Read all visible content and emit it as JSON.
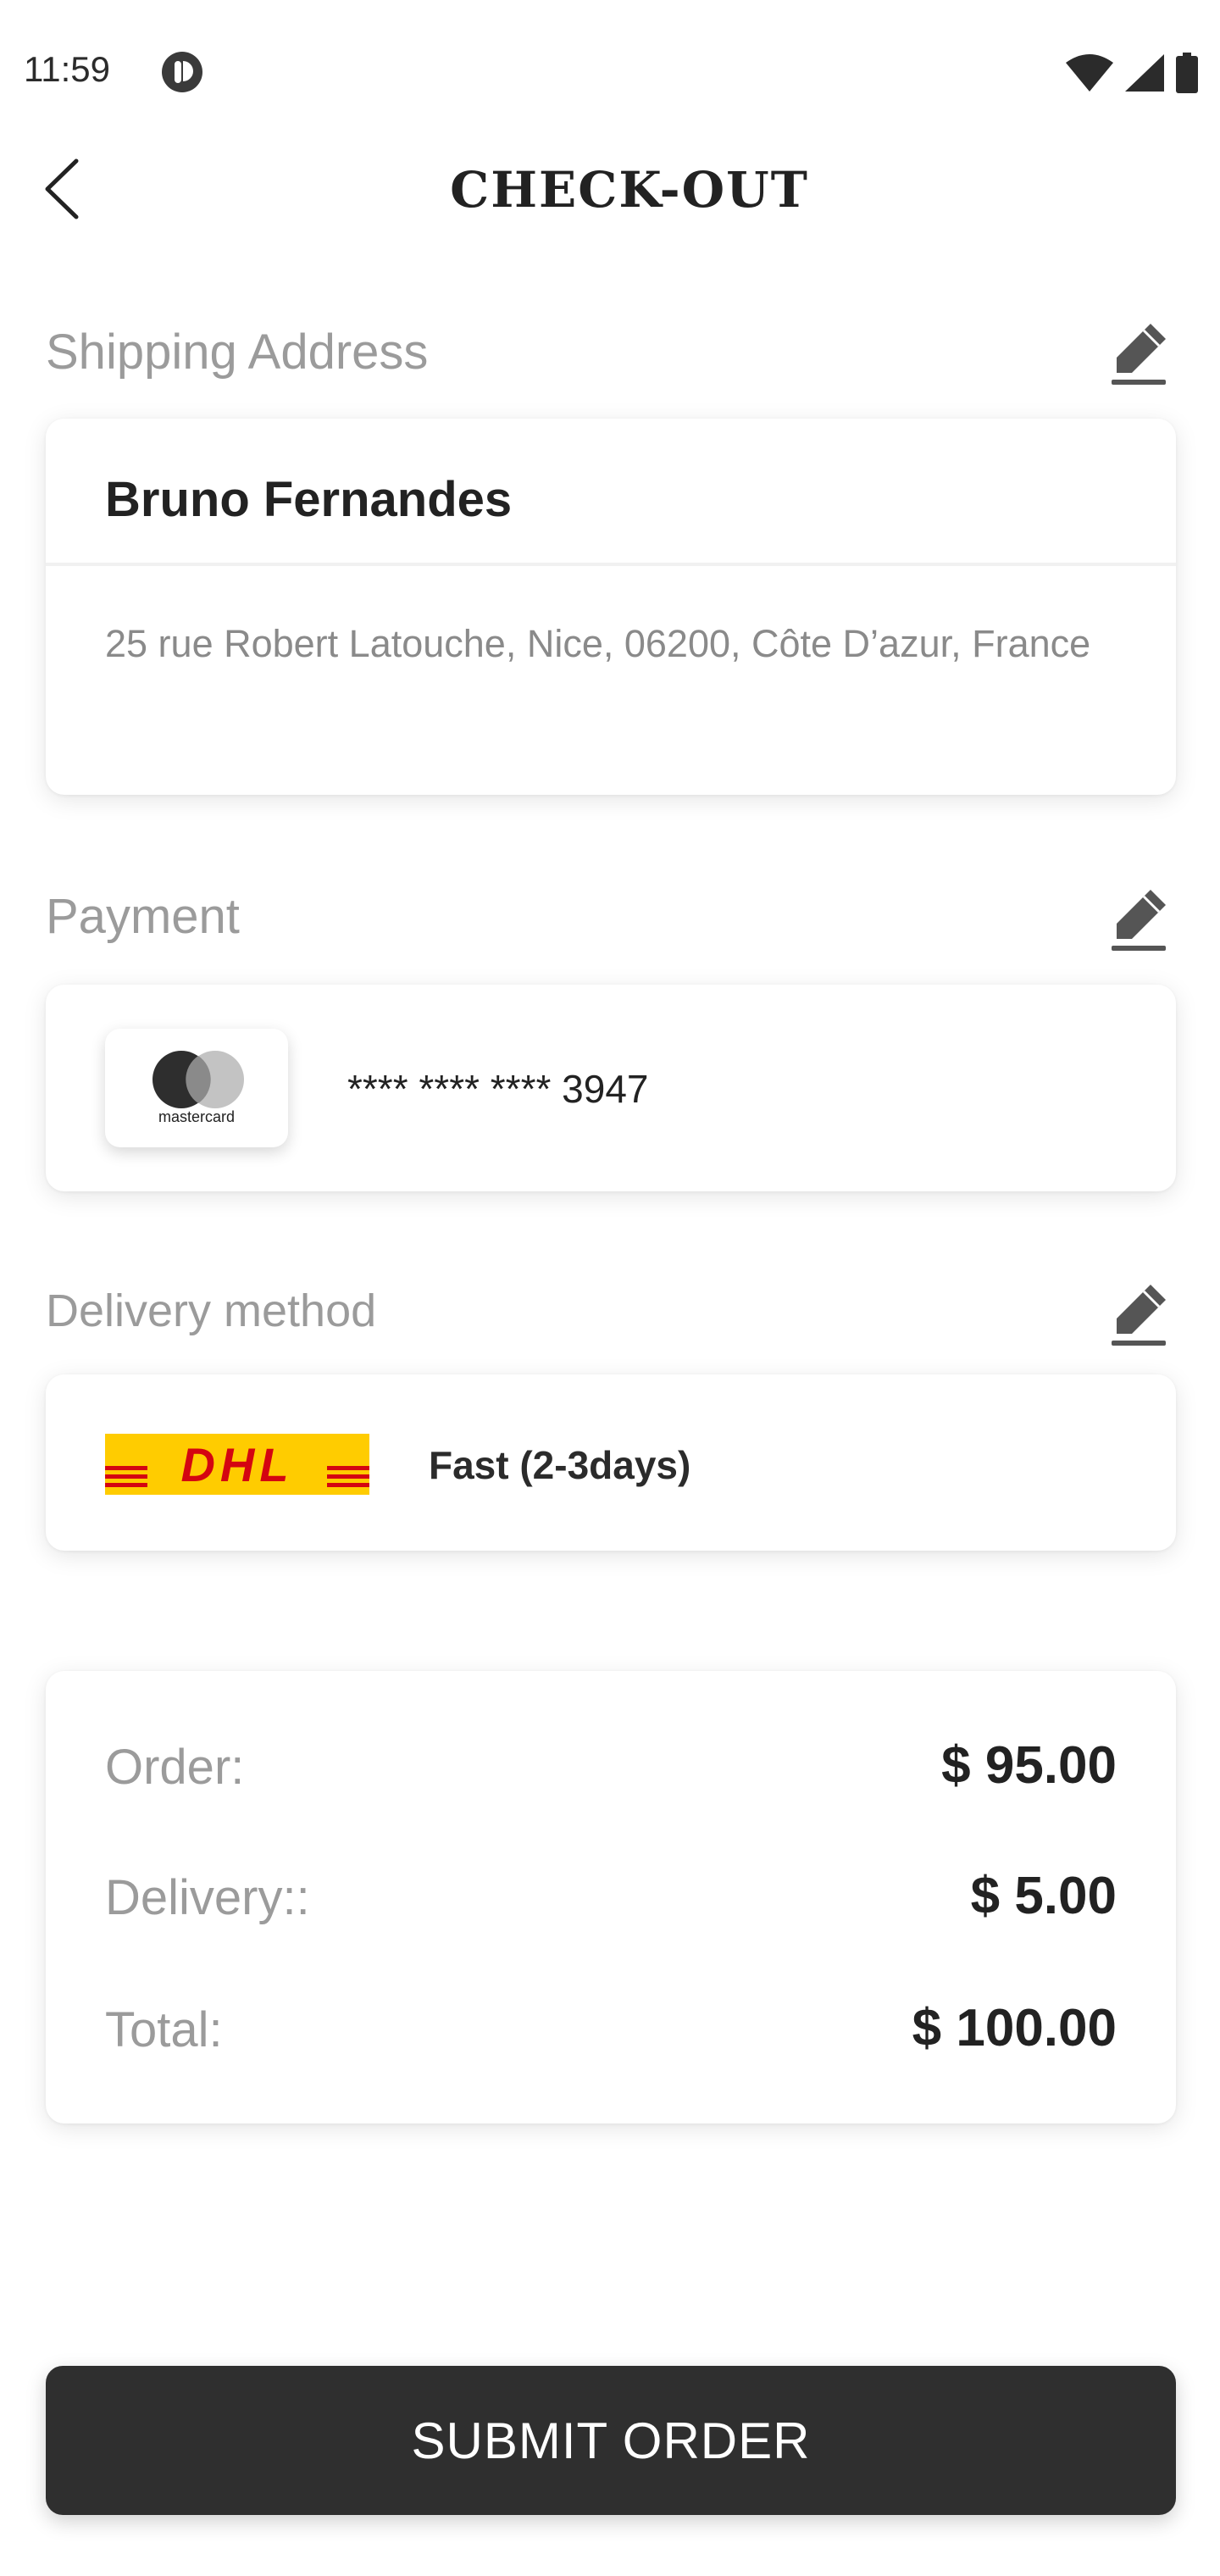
{
  "status_bar": {
    "time": "11:59"
  },
  "header": {
    "title": "CHECK-OUT"
  },
  "shipping": {
    "label": "Shipping Address",
    "name": "Bruno Fernandes",
    "address": "25 rue Robert Latouche, Nice, 06200, Côte D’azur, France"
  },
  "payment": {
    "label": "Payment",
    "card_brand": "mastercard",
    "card_number": "**** **** **** 3947"
  },
  "delivery": {
    "label": "Delivery method",
    "carrier_logo": "DHL",
    "option": "Fast (2-3days)"
  },
  "summary": {
    "rows": [
      {
        "label": "Order:",
        "value": "$ 95.00"
      },
      {
        "label": "Delivery::",
        "value": "$ 5.00"
      },
      {
        "label": "Total:",
        "value": "$ 100.00"
      }
    ]
  },
  "submit": {
    "label": "SUBMIT ORDER"
  },
  "colors": {
    "primary_dark": "#2f2f2f",
    "muted_text": "#9b9b9b",
    "dhl_yellow": "#ffcc00",
    "dhl_red": "#d40511"
  }
}
